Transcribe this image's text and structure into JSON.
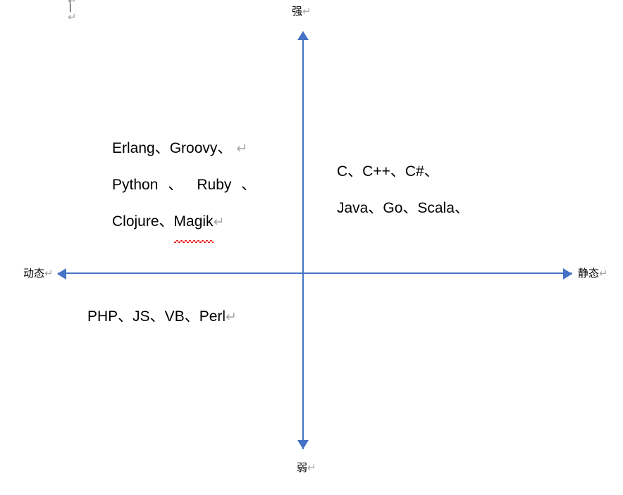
{
  "document": {
    "type": "four-quadrant-diagram",
    "background_color": "#ffffff",
    "axis_color": "#4472C4",
    "text_color": "#000000",
    "pilcrow_color": "#a6a6a6",
    "spellcheck_underline_color": "#e8221b"
  },
  "axes": {
    "top_label": "强",
    "bottom_label": "弱",
    "left_label": "动态",
    "right_label": "静态",
    "pilcrow_glyph": "↵",
    "vertical_meaning": "强 (strong) to 弱 (weak)",
    "horizontal_meaning": "动态 (dynamic) to 静态 (static)"
  },
  "quadrants": {
    "upper_left": {
      "name": "dynamic-strong",
      "lines": [
        {
          "text": "Erlang、Groovy、",
          "return_mark": "↵"
        },
        {
          "part1": "Python",
          "sep1": "、",
          "part2": "Ruby",
          "sep2": "、",
          "return_mark": ""
        },
        {
          "prefix": "Clojure、",
          "misspelled": "Magik",
          "return_mark": "↵"
        }
      ]
    },
    "upper_right": {
      "name": "static-strong",
      "lines": [
        {
          "text": "C、C++、C#、"
        },
        {
          "text": "Java、Go、Scala、"
        }
      ]
    },
    "lower_left": {
      "name": "dynamic-weak",
      "lines": [
        {
          "text": "PHP、JS、VB、Perl",
          "return_mark": "↵"
        }
      ]
    },
    "lower_right": {
      "name": "static-weak",
      "lines": []
    }
  },
  "top_of_page": {
    "caret": "|",
    "mark_top": "↵",
    "mark_second": "↵"
  }
}
